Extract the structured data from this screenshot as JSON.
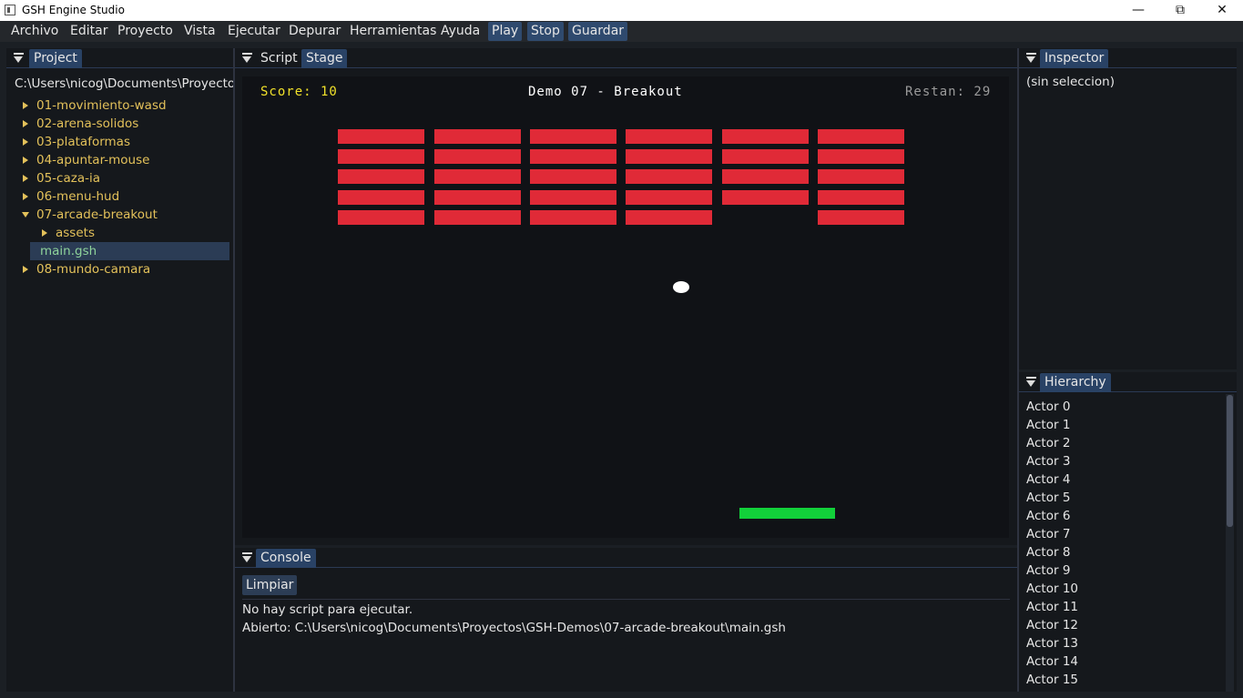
{
  "window": {
    "title": "GSH Engine Studio"
  },
  "menu": {
    "items": [
      "Archivo",
      "Editar",
      "Proyecto",
      "Vista",
      "Ejecutar",
      "Depurar",
      "Herramientas",
      "Ayuda"
    ],
    "actions": [
      "Play",
      "Stop",
      "Guardar"
    ]
  },
  "project": {
    "tab": "Project",
    "path": "C:\\Users\\nicog\\Documents\\Proyectos\\",
    "folders": [
      "01-movimiento-wasd",
      "02-arena-solidos",
      "03-plataformas",
      "04-apuntar-mouse",
      "05-caza-ia",
      "06-menu-hud",
      "07-arcade-breakout"
    ],
    "open_folder_children": {
      "folder": "assets",
      "file": "main.gsh"
    },
    "last_folder": "08-mundo-camara"
  },
  "editor": {
    "tabs": [
      "Script",
      "Stage"
    ],
    "active_tab": "Stage"
  },
  "game": {
    "score": "Score: 10",
    "title": "Demo 07 - Breakout",
    "remaining": "Restan: 29",
    "colors": {
      "brick": "#e02a37",
      "paddle": "#12d03a",
      "ball": "#ffffff",
      "score": "#f1e12a",
      "title": "#ffffff",
      "remaining": "#9a9a9a"
    },
    "brick_grid": [
      [
        1,
        1,
        1,
        1,
        1,
        1
      ],
      [
        1,
        1,
        1,
        1,
        1,
        1
      ],
      [
        1,
        1,
        1,
        1,
        1,
        1
      ],
      [
        1,
        1,
        1,
        1,
        1,
        1
      ],
      [
        1,
        1,
        1,
        1,
        0,
        1
      ]
    ]
  },
  "console": {
    "tab": "Console",
    "clear_button": "Limpiar",
    "lines": [
      "No hay script para ejecutar.",
      "Abierto: C:\\Users\\nicog\\Documents\\Proyectos\\GSH-Demos\\07-arcade-breakout\\main.gsh"
    ]
  },
  "inspector": {
    "tab": "Inspector",
    "empty_text": "(sin seleccion)"
  },
  "hierarchy": {
    "tab": "Hierarchy",
    "actors": [
      "Actor 0",
      "Actor 1",
      "Actor 2",
      "Actor 3",
      "Actor 4",
      "Actor 5",
      "Actor 6",
      "Actor 7",
      "Actor 8",
      "Actor 9",
      "Actor 10",
      "Actor 11",
      "Actor 12",
      "Actor 13",
      "Actor 14",
      "Actor 15"
    ]
  }
}
